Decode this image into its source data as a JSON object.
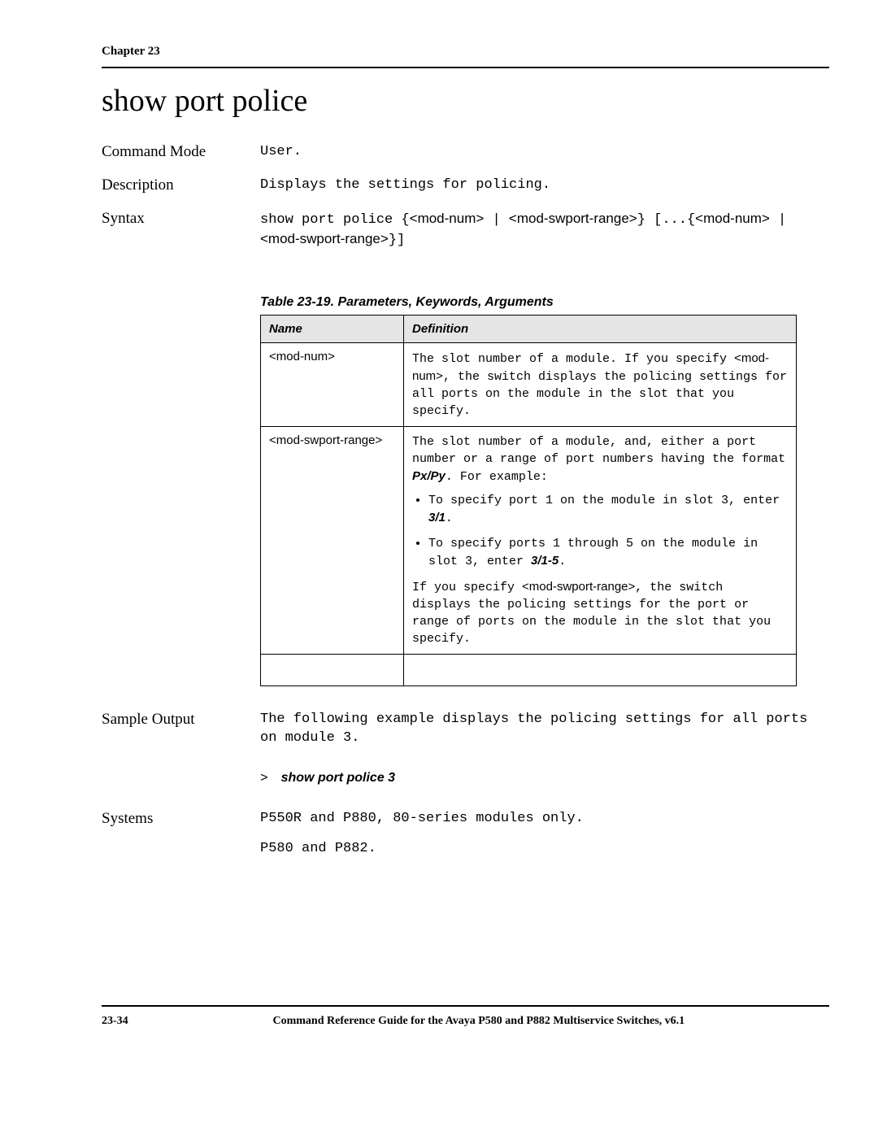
{
  "header": {
    "chapter": "Chapter 23"
  },
  "title": "show port police",
  "rows": {
    "command_mode": {
      "label": "Command Mode",
      "value": "User."
    },
    "description": {
      "label": "Description",
      "value": "Displays the settings for policing."
    },
    "syntax": {
      "label": "Syntax",
      "line": "show port police {<mod-num> | <mod-swport-range>} [...{<mod-num> | <mod-swport-range>}]"
    },
    "sample_output": {
      "label": "Sample Output",
      "text": "The following example displays the policing settings for all ports on module 3.",
      "prompt": ">",
      "command": "show port police 3"
    },
    "systems": {
      "label": "Systems",
      "line1": "P550R and P880, 80-series modules only.",
      "line2": "P580 and P882."
    }
  },
  "table": {
    "caption": "Table 23-19.  Parameters, Keywords, Arguments",
    "headers": {
      "name": "Name",
      "definition": "Definition"
    },
    "rows": [
      {
        "name": "<mod-num>",
        "def_pre": "The slot number of a module. If you specify ",
        "def_sans1": "<mod-num>",
        "def_post": ", the switch displays the policing settings for all ports on the module in the slot that you specify."
      },
      {
        "name": "<mod-swport-range>",
        "def_pre": "The slot number of a module, and, either a port number or a range of port numbers having the format ",
        "def_sans_px": "Px/Py",
        "def_post1": ". For example:",
        "bullet1_pre": "To specify port 1 on the module in slot 3, enter ",
        "bullet1_em": "3/1",
        "bullet1_post": ".",
        "bullet2_pre": "To specify ports 1 through 5 on the module in slot 3, enter ",
        "bullet2_em": "3/1-5",
        "bullet2_post": ".",
        "def_tail_pre": "If you specify ",
        "def_tail_sans": "<mod-swport-range>",
        "def_tail_post": ", the switch displays the policing settings for the port or range of ports on the module in the slot that you specify."
      }
    ]
  },
  "footer": {
    "page": "23-34",
    "doc": "Command Reference Guide for the Avaya P580 and P882 Multiservice Switches, v6.1"
  }
}
